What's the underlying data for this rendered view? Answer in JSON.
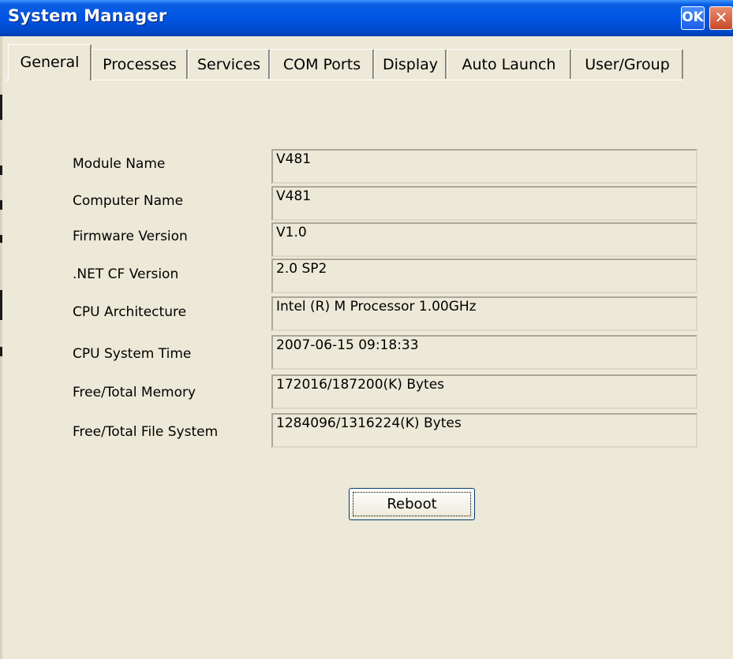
{
  "window": {
    "title": "System Manager",
    "ok_label": "OK",
    "close_label": "✕"
  },
  "tabs": [
    {
      "label": "General",
      "active": true
    },
    {
      "label": "Processes",
      "active": false
    },
    {
      "label": "Services",
      "active": false
    },
    {
      "label": "COM Ports",
      "active": false
    },
    {
      "label": "Display",
      "active": false
    },
    {
      "label": "Auto Launch",
      "active": false
    },
    {
      "label": "User/Group",
      "active": false
    }
  ],
  "general": {
    "fields": [
      {
        "label": "Module Name",
        "value": "V481"
      },
      {
        "label": "Computer Name",
        "value": "V481"
      },
      {
        "label": "Firmware Version",
        "value": "V1.0"
      },
      {
        "label": ".NET CF Version",
        "value": "2.0 SP2"
      },
      {
        "label": "CPU Architecture",
        "value": "Intel (R) M Processor 1.00GHz"
      },
      {
        "label": "CPU System Time",
        "value": "2007-06-15 09:18:33"
      },
      {
        "label": "Free/Total Memory",
        "value": "172016/187200(K) Bytes"
      },
      {
        "label": "Free/Total File System",
        "value": "1284096/1316224(K) Bytes"
      }
    ],
    "reboot_label": "Reboot"
  },
  "colors": {
    "titlebar": "#0054e3",
    "window_bg": "#ece9d8",
    "close_button": "#c64a2a"
  },
  "icons": {
    "ok": "ok-icon",
    "close": "close-icon"
  }
}
